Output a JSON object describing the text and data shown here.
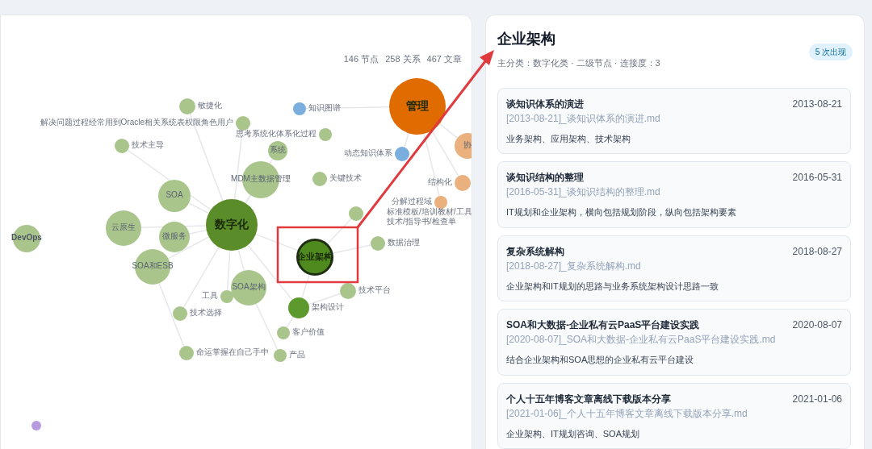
{
  "graph": {
    "stats": [
      "146 节点",
      "258 关系",
      "467 文章"
    ],
    "nodes": [
      {
        "label": "敏捷化",
        "color": "#a9c58c",
        "selected": false
      },
      {
        "label": "知识图谱",
        "color": "#7aaede",
        "selected": false
      },
      {
        "label": "管理",
        "color": "#e06b00",
        "selected": false
      },
      {
        "label": "解决问题过程经常用到Oracle相关系统表权限角色用户",
        "color": "#a9c58c",
        "selected": false
      },
      {
        "label": "技术主导",
        "color": "#a9c58c",
        "selected": false
      },
      {
        "label": "思考系统化体系化过程",
        "color": "#a9c58c",
        "selected": false
      },
      {
        "label": "系统",
        "color": "#a9c58c",
        "selected": false
      },
      {
        "label": "动态知识体系",
        "color": "#7aaede",
        "selected": false
      },
      {
        "label": "协",
        "color": "#eab07d",
        "selected": false
      },
      {
        "label": "MDM主数据管理",
        "color": "#a9c58c",
        "selected": false
      },
      {
        "label": "关键技术",
        "color": "#a9c58c",
        "selected": false
      },
      {
        "label": "结构化",
        "color": "#eab07d",
        "selected": false
      },
      {
        "label": "SOA",
        "color": "#a9c58c",
        "selected": false
      },
      {
        "label": "分解过程域",
        "color": "#eab07d",
        "selected": false
      },
      {
        "label": "标准模板/培训教材/工具技术/指导书/检查单",
        "color": "#a9c58c",
        "selected": false
      },
      {
        "label": "DevOps",
        "color": "#a9c58c",
        "selected": false
      },
      {
        "label": "云原生",
        "color": "#a9c58c",
        "selected": false
      },
      {
        "label": "微服务",
        "color": "#a9c58c",
        "selected": false
      },
      {
        "label": "数字化",
        "color": "#5b8c2a",
        "selected": false
      },
      {
        "label": "数据治理",
        "color": "#a9c58c",
        "selected": false
      },
      {
        "label": "SOA和ESB",
        "color": "#a9c58c",
        "selected": false
      },
      {
        "label": "企业架构",
        "color": "#4f8a1e",
        "selected": true
      },
      {
        "label": "工具",
        "color": "#a9c58c",
        "selected": false
      },
      {
        "label": "SOA架构",
        "color": "#a9c58c",
        "selected": false
      },
      {
        "label": "技术平台",
        "color": "#a9c58c",
        "selected": false
      },
      {
        "label": "技术选择",
        "color": "#a9c58c",
        "selected": false
      },
      {
        "label": "架构设计",
        "color": "#5d9a2d",
        "selected": false
      },
      {
        "label": "客户价值",
        "color": "#a9c58c",
        "selected": false
      },
      {
        "label": "命运掌握在自己手中",
        "color": "#a9c58c",
        "selected": false
      },
      {
        "label": "产品",
        "color": "#a9c58c",
        "selected": false
      }
    ]
  },
  "detail": {
    "title": "企业架构",
    "subtitle": "主分类：数字化类 · 二级节点 · 连接度：3",
    "badge": "5 次出现",
    "articles": [
      {
        "title": "谈知识体系的演进",
        "date": "2013-08-21",
        "file": "[2013-08-21]_谈知识体系的演进.md",
        "summary": "业务架构、应用架构、技术架构"
      },
      {
        "title": "谈知识结构的整理",
        "date": "2016-05-31",
        "file": "[2016-05-31]_谈知识结构的整理.md",
        "summary": "IT规划和企业架构，横向包括规划阶段，纵向包括架构要素"
      },
      {
        "title": "复杂系统解构",
        "date": "2018-08-27",
        "file": "[2018-08-27]_复杂系统解构.md",
        "summary": "企业架构和IT规划的思路与业务系统架构设计思路一致"
      },
      {
        "title": "SOA和大数据-企业私有云PaaS平台建设实践",
        "date": "2020-08-07",
        "file": "[2020-08-07]_SOA和大数据-企业私有云PaaS平台建设实践.md",
        "summary": "结合企业架构和SOA思想的企业私有云平台建设"
      },
      {
        "title": "个人十五年博客文章离线下载版本分享",
        "date": "2021-01-06",
        "file": "[2021-01-06]_个人十五年博客文章离线下载版本分享.md",
        "summary": "企业架构、IT规划咨询、SOA规划"
      }
    ]
  }
}
